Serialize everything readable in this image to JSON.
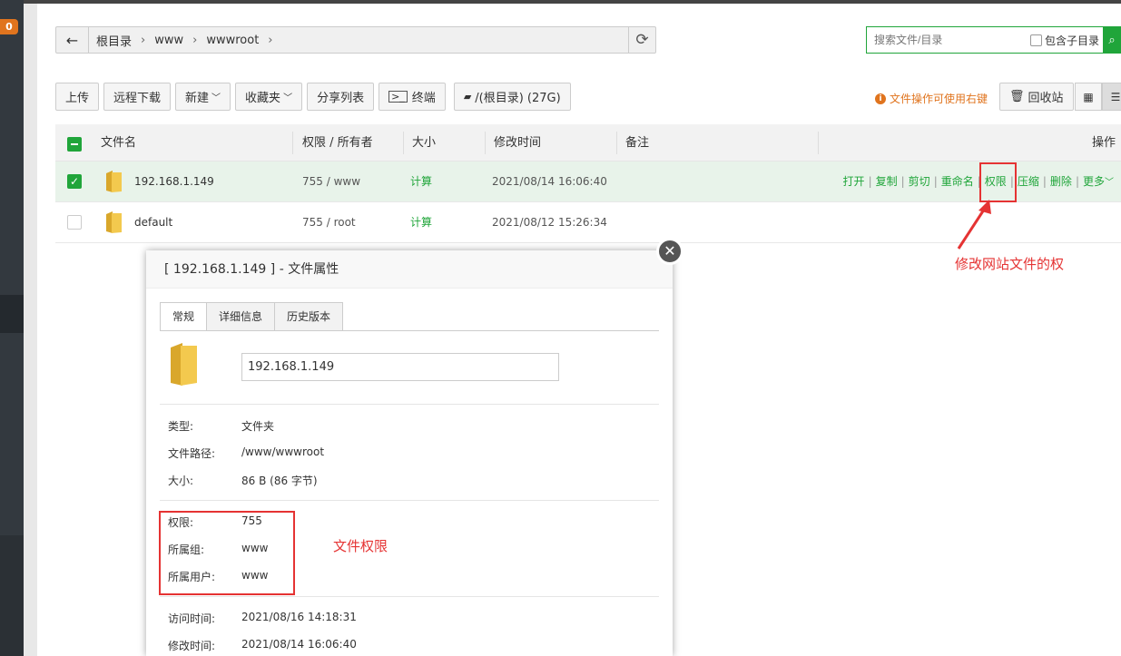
{
  "sidebar": {
    "badge": "0"
  },
  "path": {
    "back_icon": "arrow-left-icon",
    "crumbs": [
      "根目录",
      "www",
      "wwwroot"
    ],
    "sep": "›",
    "refresh_icon": "refresh-icon"
  },
  "search": {
    "placeholder": "搜索文件/目录",
    "subdir_label": "包含子目录"
  },
  "toolbar": {
    "upload": "上传",
    "remote_download": "远程下载",
    "new": "新建",
    "favorites": "收藏夹",
    "share_list": "分享列表",
    "terminal": "终端",
    "disk": "/(根目录) (27G)",
    "tip": "文件操作可使用右键",
    "recycle": "回收站"
  },
  "table": {
    "headers": {
      "name": "文件名",
      "perm": "权限 / 所有者",
      "size": "大小",
      "mtime": "修改时间",
      "note": "备注",
      "ops": "操作"
    },
    "rows": [
      {
        "name": "192.168.1.149",
        "perm": "755 / www",
        "size": "计算",
        "mtime": "2021/08/14 16:06:40",
        "selected": true
      },
      {
        "name": "default",
        "perm": "755 / root",
        "size": "计算",
        "mtime": "2021/08/12 15:26:34",
        "selected": false
      }
    ],
    "ops": [
      "打开",
      "复制",
      "剪切",
      "重命名",
      "权限",
      "压缩",
      "删除",
      "更多"
    ]
  },
  "annotations": {
    "arrow_note": "修改网站文件的权",
    "perm_note": "文件权限"
  },
  "modal": {
    "title": "[ 192.168.1.149 ] - 文件属性",
    "tabs": [
      "常规",
      "详细信息",
      "历史版本"
    ],
    "name": "192.168.1.149",
    "type_label": "类型:",
    "type_value": "文件夹",
    "path_label": "文件路径:",
    "path_value": "/www/wwwroot",
    "size_label": "大小:",
    "size_value": "86 B (86 字节)",
    "perm_label": "权限:",
    "perm_value": "755",
    "group_label": "所属组:",
    "group_value": "www",
    "user_label": "所属用户:",
    "user_value": "www",
    "atime_label": "访问时间:",
    "atime_value": "2021/08/16 14:18:31",
    "mtime_label": "修改时间:",
    "mtime_value": "2021/08/14 16:06:40"
  },
  "colors": {
    "accent": "#20a53a",
    "annotation": "#e53333",
    "warning": "#e0741e"
  }
}
